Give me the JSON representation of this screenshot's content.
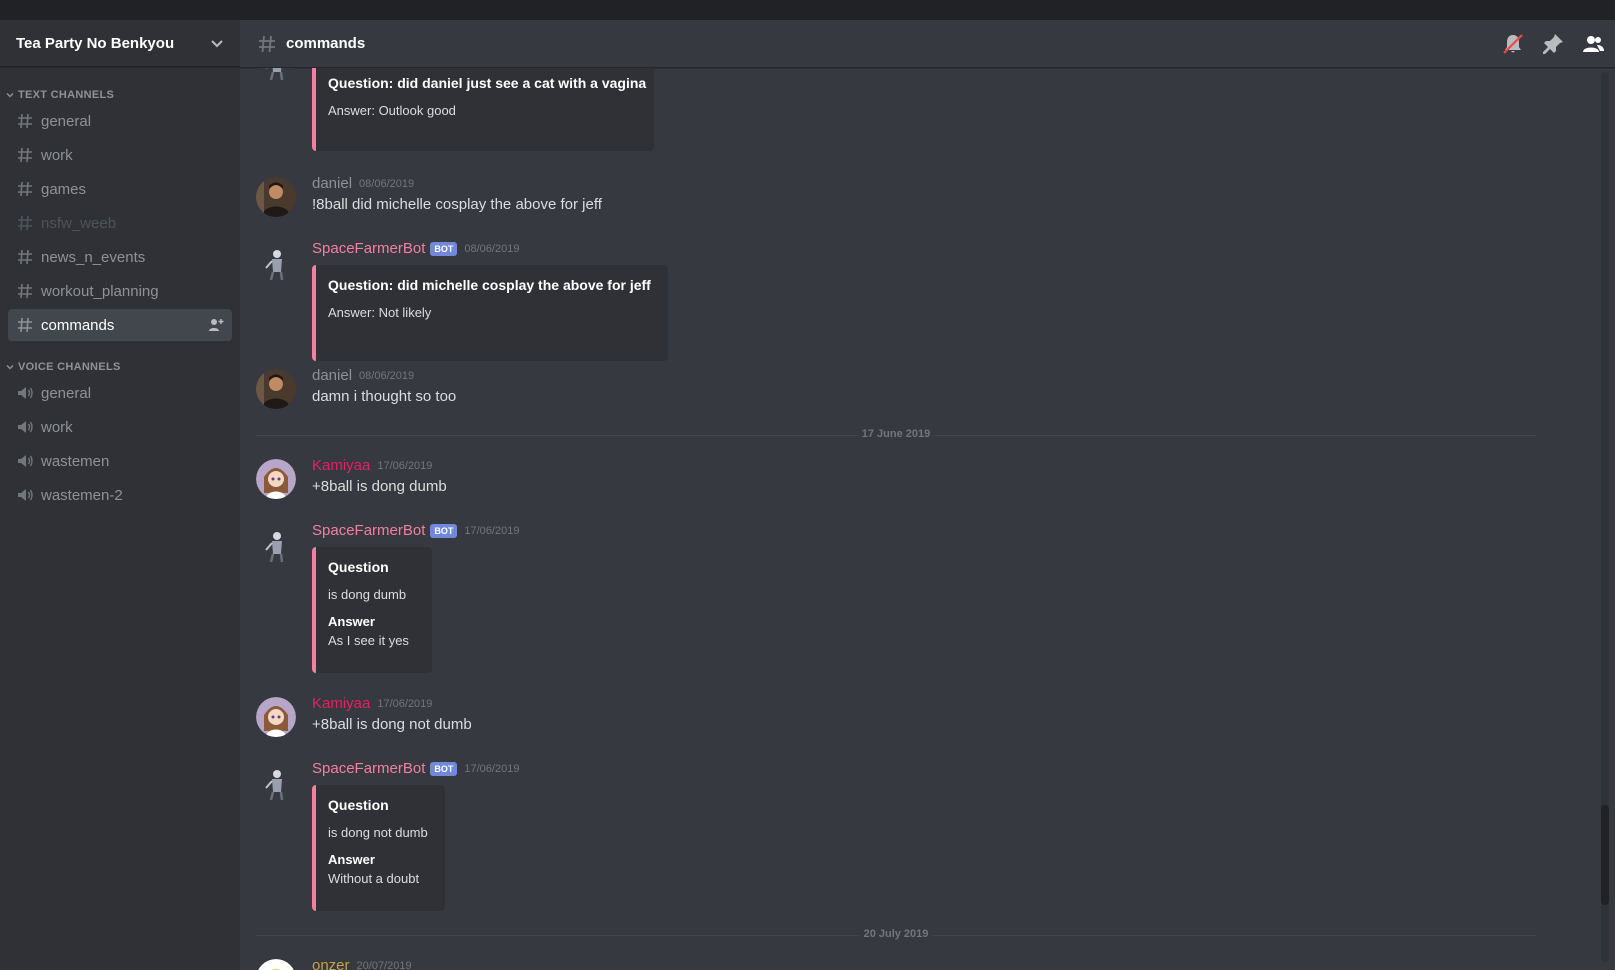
{
  "server": {
    "name": "Tea Party No Benkyou"
  },
  "categories": {
    "text": "TEXT CHANNELS",
    "voice": "VOICE CHANNELS"
  },
  "text_channels": [
    "general",
    "work",
    "games",
    "nsfw_weeb",
    "news_n_events",
    "workout_planning",
    "commands"
  ],
  "voice_channels": [
    "general",
    "work",
    "wastemen",
    "wastemen-2"
  ],
  "header": {
    "channel": "commands"
  },
  "badge": "BOT",
  "messages": {
    "m0": {
      "title": "Question: did daniel just see a cat with a vagina",
      "answer": "Answer: Outlook good"
    },
    "m1": {
      "author": "daniel",
      "time": "08/06/2019",
      "text": "!8ball did michelle cosplay the above for jeff"
    },
    "m2": {
      "author": "SpaceFarmerBot",
      "time": "08/06/2019",
      "title": "Question: did michelle cosplay the above for jeff",
      "answer": "Answer: Not likely"
    },
    "m3": {
      "author": "daniel",
      "time": "08/06/2019",
      "text": "damn i thought so too"
    },
    "d1": "17 June 2019",
    "m4": {
      "author": "Kamiyaa",
      "time": "17/06/2019",
      "text": "+8ball is dong dumb"
    },
    "m5": {
      "author": "SpaceFarmerBot",
      "time": "17/06/2019",
      "title": "Question",
      "desc": "is dong dumb",
      "field_name": "Answer",
      "field_value": "As I see it yes"
    },
    "m6": {
      "author": "Kamiyaa",
      "time": "17/06/2019",
      "text": "+8ball is dong not dumb"
    },
    "m7": {
      "author": "SpaceFarmerBot",
      "time": "17/06/2019",
      "title": "Question",
      "desc": "is dong not dumb",
      "field_name": "Answer",
      "field_value": "Without a doubt"
    },
    "d2": "20 July 2019",
    "m8": {
      "author": "onzer",
      "time": "20/07/2019"
    }
  }
}
